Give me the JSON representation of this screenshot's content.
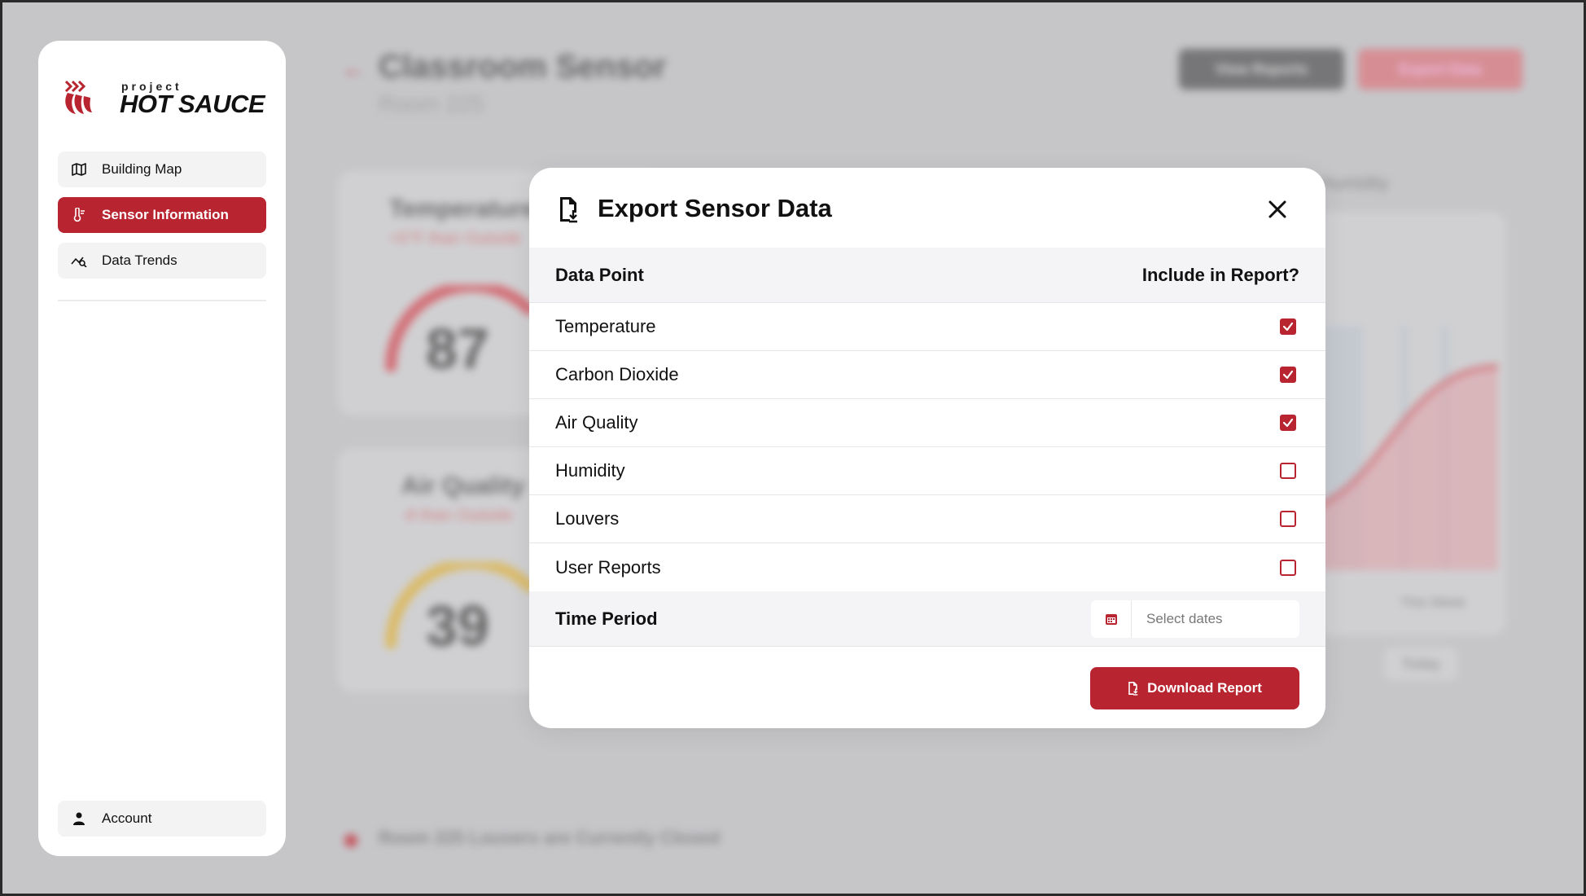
{
  "brand": {
    "small": "project",
    "big": "HOT SAUCE"
  },
  "sidebar": {
    "items": [
      {
        "label": "Building Map",
        "icon": "map-icon",
        "active": false
      },
      {
        "label": "Sensor Information",
        "icon": "thermometer-icon",
        "active": true
      },
      {
        "label": "Data Trends",
        "icon": "trend-icon",
        "active": false
      }
    ],
    "account": {
      "label": "Account",
      "icon": "user-icon"
    }
  },
  "background": {
    "title": "Classroom Sensor",
    "subtitle": "Room 225",
    "view_reports": "View Reports",
    "export_data": "Export Data",
    "temperature_title": "Temperature",
    "temperature_sub": "+5°F than Outside",
    "temperature_value": "87",
    "air_quality_title": "Air Quality",
    "air_quality_sub": "-8 than Outside",
    "air_quality_value": "39",
    "humidity_label": "Humidity",
    "this_week": "This Week",
    "today": "Today",
    "footer": "Room 225 Louvers are Currently Closed"
  },
  "modal": {
    "title": "Export Sensor Data",
    "col_data_point": "Data Point",
    "col_include": "Include in Report?",
    "rows": [
      {
        "label": "Temperature",
        "checked": true
      },
      {
        "label": "Carbon Dioxide",
        "checked": true
      },
      {
        "label": "Air Quality",
        "checked": true
      },
      {
        "label": "Humidity",
        "checked": false
      },
      {
        "label": "Louvers",
        "checked": false
      },
      {
        "label": "User Reports",
        "checked": false
      }
    ],
    "time_period_label": "Time Period",
    "date_placeholder": "Select dates",
    "download_label": "Download Report"
  },
  "colors": {
    "accent": "#b82530",
    "backdrop": "#c6c6c9"
  }
}
